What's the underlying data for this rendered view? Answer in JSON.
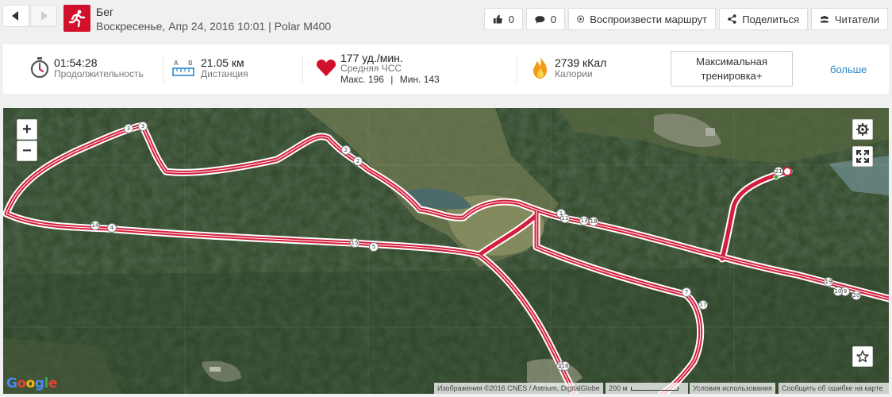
{
  "header": {
    "title": "Бег",
    "subtitle": "Воскресенье, Апр 24, 2016 10:01 | Polar M400",
    "likes_count": "0",
    "comments_count": "0",
    "replay_label": "Воспроизвести маршрут",
    "share_label": "Поделиться",
    "followers_label": "Читатели"
  },
  "stats": {
    "duration": {
      "value": "01:54:28",
      "label": "Продолжительность"
    },
    "distance": {
      "value": "21.05 км",
      "label": "Дистанция",
      "icon_letters": [
        "A",
        "B"
      ]
    },
    "heart_rate": {
      "value": "177 уд./мин.",
      "label": "Средняя ЧСС",
      "max": "Макс. 196",
      "separator": "|",
      "min": "Мин. 143"
    },
    "calories": {
      "value": "2739 кКал",
      "label": "Калории"
    },
    "max_workout_label": "Максимальная тренировка+",
    "more_label": "больше"
  },
  "map": {
    "zoom_in": "+",
    "zoom_out": "−",
    "attribution": "Изображения ©2016 CNES / Astrium, DigitalGlobe",
    "scale_label": "200 м",
    "terms": "Условия использования",
    "report": "Сообщить об ошибке на карте",
    "google": "Google",
    "km_markers": [
      "1",
      "2",
      "2",
      "3",
      "3",
      "4",
      "5",
      "6",
      "7",
      "8",
      "9",
      "10",
      "11",
      "13",
      "14",
      "15",
      "16",
      "17",
      "18",
      "19",
      "20",
      "21"
    ],
    "colors": {
      "route": "#d41f3c",
      "brand": "#d1102c",
      "link": "#2a87c8"
    }
  }
}
